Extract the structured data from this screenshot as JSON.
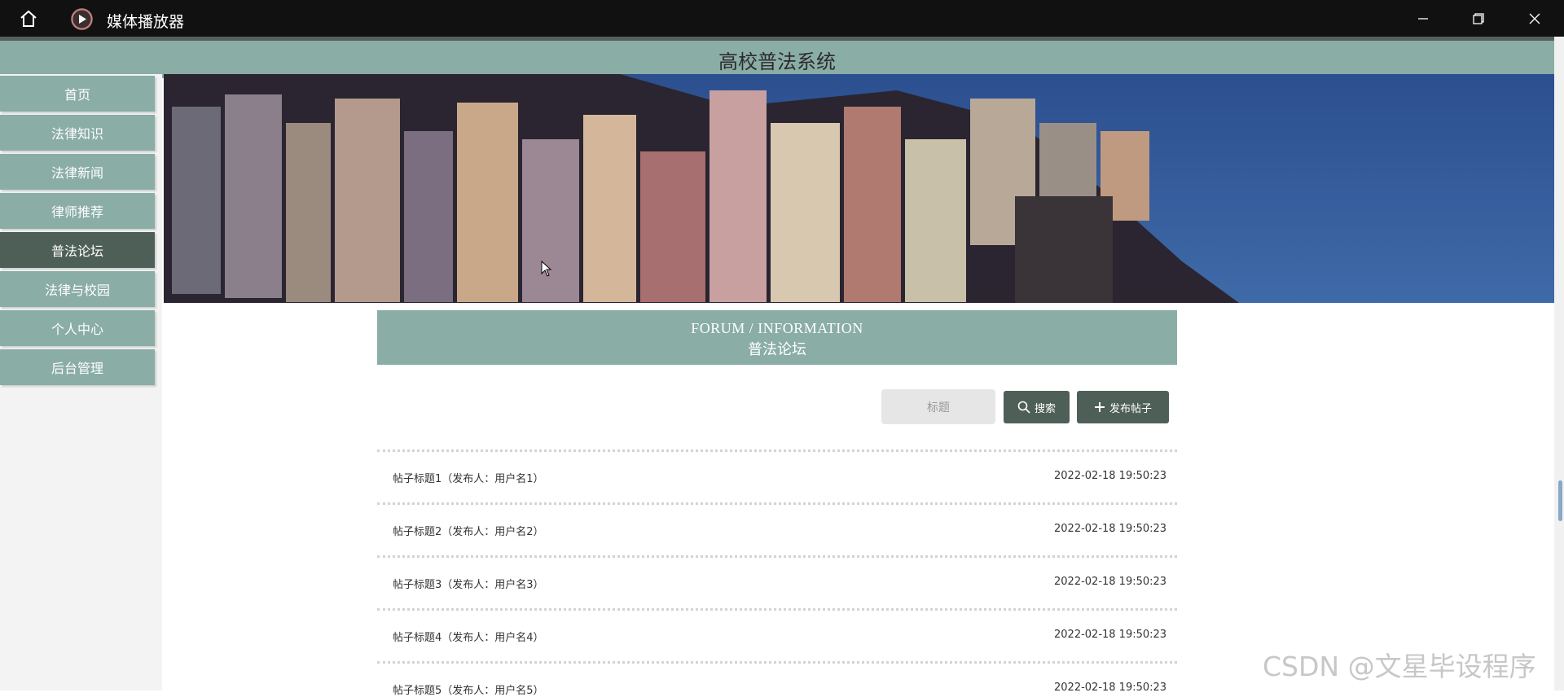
{
  "window": {
    "app_title": "媒体播放器",
    "icons": [
      "home-icon",
      "media-player-icon",
      "minimize-icon",
      "restore-icon",
      "close-icon"
    ]
  },
  "header": {
    "title": "高校普法系统"
  },
  "sidebar": {
    "items": [
      {
        "label": "首页"
      },
      {
        "label": "法律知识"
      },
      {
        "label": "法律新闻"
      },
      {
        "label": "律师推荐"
      },
      {
        "label": "普法论坛",
        "active": true
      },
      {
        "label": "法律与校园"
      },
      {
        "label": "个人中心"
      },
      {
        "label": "后台管理"
      }
    ]
  },
  "section": {
    "title_en": "FORUM / INFORMATION",
    "title_zh": "普法论坛"
  },
  "search": {
    "placeholder": "标题",
    "search_label": "搜索",
    "post_label": "发布帖子"
  },
  "posts": [
    {
      "title": "帖子标题1（发布人：用户名1）",
      "date": "2022-02-18 19:50:23"
    },
    {
      "title": "帖子标题2（发布人：用户名2）",
      "date": "2022-02-18 19:50:23"
    },
    {
      "title": "帖子标题3（发布人：用户名3）",
      "date": "2022-02-18 19:50:23"
    },
    {
      "title": "帖子标题4（发布人：用户名4）",
      "date": "2022-02-18 19:50:23"
    },
    {
      "title": "帖子标题5（发布人：用户名5）",
      "date": "2022-02-18 19:50:23"
    }
  ],
  "watermark": "CSDN @文星毕设程序",
  "colors": {
    "accent": "#8aada6",
    "active": "#4e5f58",
    "titlebar": "#111111"
  }
}
